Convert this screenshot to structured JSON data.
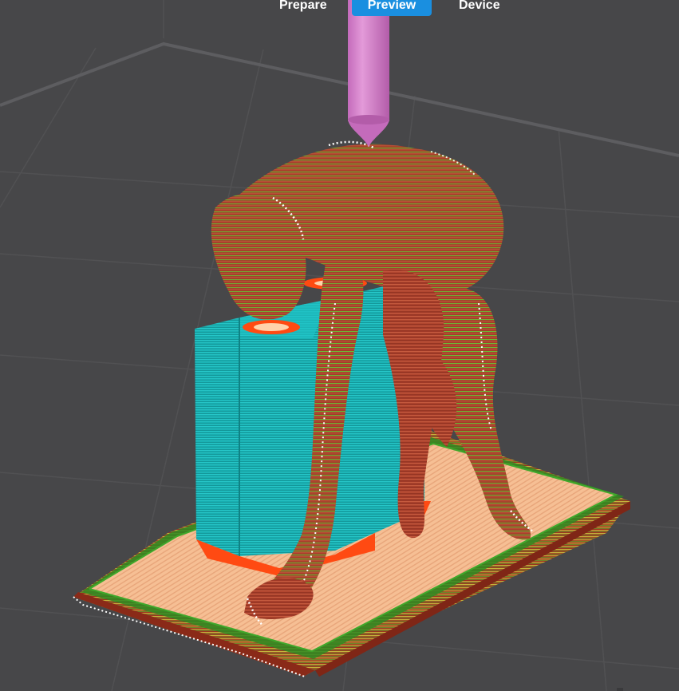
{
  "app": {
    "tabs": [
      {
        "id": "prepare",
        "label": "Prepare",
        "active": false
      },
      {
        "id": "preview",
        "label": "Preview",
        "active": true
      },
      {
        "id": "device",
        "label": "Device",
        "active": false
      }
    ]
  },
  "colors": {
    "background": "#474749",
    "plate_line": "#5b5b5d",
    "active_tab": "#1a8fe0",
    "nozzle": "#d47ccc",
    "outer_wall": "#b84a32",
    "inner_wall": "#5fb92f",
    "support": "#1bb3b5",
    "support_interface": "#ff4a12",
    "solid_infill": "#f4b78a",
    "sparse_infill": "#9a2a1a",
    "seam": "#ffffff"
  },
  "icons": {
    "nozzle": "nozzle-icon"
  }
}
